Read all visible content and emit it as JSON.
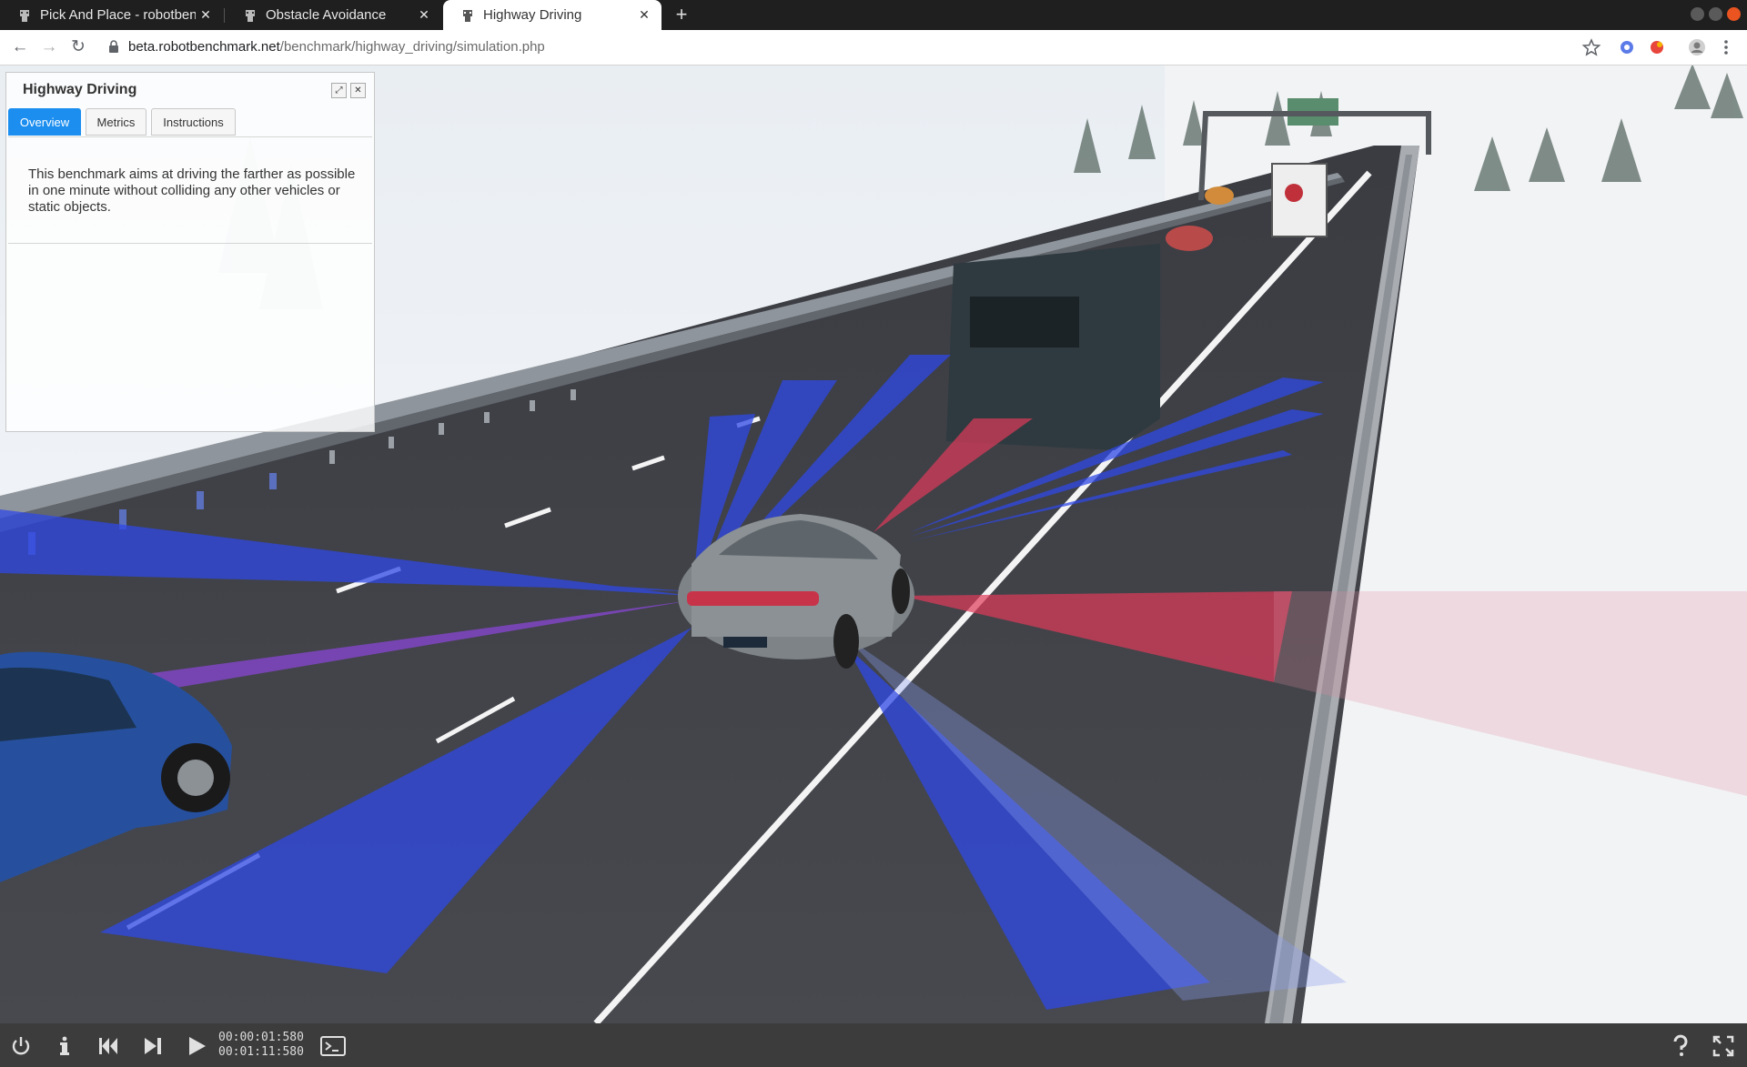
{
  "browser": {
    "tabs": [
      {
        "title": "Pick And Place - robotben",
        "active": false
      },
      {
        "title": "Obstacle Avoidance",
        "active": false
      },
      {
        "title": "Highway Driving",
        "active": true
      }
    ],
    "new_tab_label": "+",
    "url_host": "beta.robotbenchmark.net",
    "url_path": "/benchmark/highway_driving/simulation.php"
  },
  "panel": {
    "title": "Highway Driving",
    "tabs": [
      "Overview",
      "Metrics",
      "Instructions"
    ],
    "active_tab": "Overview",
    "description": "This benchmark aims at driving the farther as possible in one minute without colliding any other vehicles or static objects."
  },
  "player": {
    "elapsed_time": "00:00:01:580",
    "total_time": "00:01:11:580"
  },
  "colors": {
    "sensor_blue": "#2f48e6",
    "sensor_red": "#e03a5a",
    "active_tab": "#1b8ef0"
  }
}
